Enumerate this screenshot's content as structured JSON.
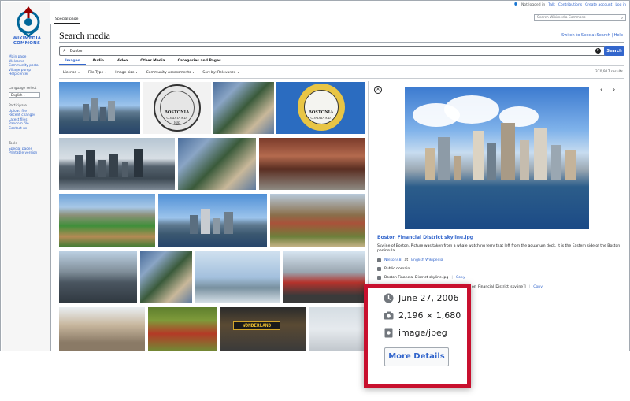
{
  "sidebar": {
    "logo_text": "WIKIMEDIA COMMONS",
    "nav": [
      "Main page",
      "Welcome",
      "Community portal",
      "Village pump",
      "Help center"
    ],
    "language_label": "Language select",
    "language_value": "English",
    "participate_head": "Participate",
    "participate": [
      "Upload file",
      "Recent changes",
      "Latest files",
      "Random file",
      "Contact us"
    ],
    "tools_head": "Tools",
    "tools": [
      "Special pages",
      "Printable version"
    ]
  },
  "userbar": {
    "status": "Not logged in",
    "links": [
      "Talk",
      "Contributions",
      "Create account",
      "Log in"
    ]
  },
  "header_search": {
    "placeholder": "Search Wikimedia Commons"
  },
  "tab": {
    "label": "Special page"
  },
  "page": {
    "title": "Search media",
    "switch_link": "Switch to Special:Search | Help"
  },
  "search": {
    "value": "Boston",
    "button": "Search"
  },
  "media_tabs": [
    "Images",
    "Audio",
    "Video",
    "Other Media",
    "Categories and Pages"
  ],
  "filters": [
    "License",
    "File Type",
    "Image size",
    "Community Assessments",
    "Sort by: Relevance"
  ],
  "result_count": "370,917 results",
  "detail": {
    "title": "Boston Financial District skyline.jpg",
    "description": "Skyline of Boston. Picture was taken from a whale watching ferry that left from the aquarium dock. It is the Eastern side of the Boston peninsula.",
    "author": "Nelson48",
    "author_at": "at",
    "author_site": "English Wikipedia",
    "license": "Public domain",
    "filename": "Boston Financial District skyline.jpg",
    "copy": "Copy",
    "wikitext": "on_Financial_District_skyline]]",
    "copy2": "Copy"
  },
  "callout": {
    "date": "June 27, 2006",
    "dimensions": "2,196 × 1,680",
    "mime": "image/jpeg",
    "button": "More Details"
  },
  "thumbs": {
    "seal_text": "BOSTONIA",
    "seal_sub": "CONDITA A.D.",
    "seal_year": "1630",
    "flag_text": "BOSTONIA",
    "flag_sub": "CONDITA A.D.",
    "wonderland": "WONDERLAND"
  },
  "colors": {
    "link": "#3366cc",
    "accent_red": "#c8102e",
    "search_button": "#3366cc"
  }
}
